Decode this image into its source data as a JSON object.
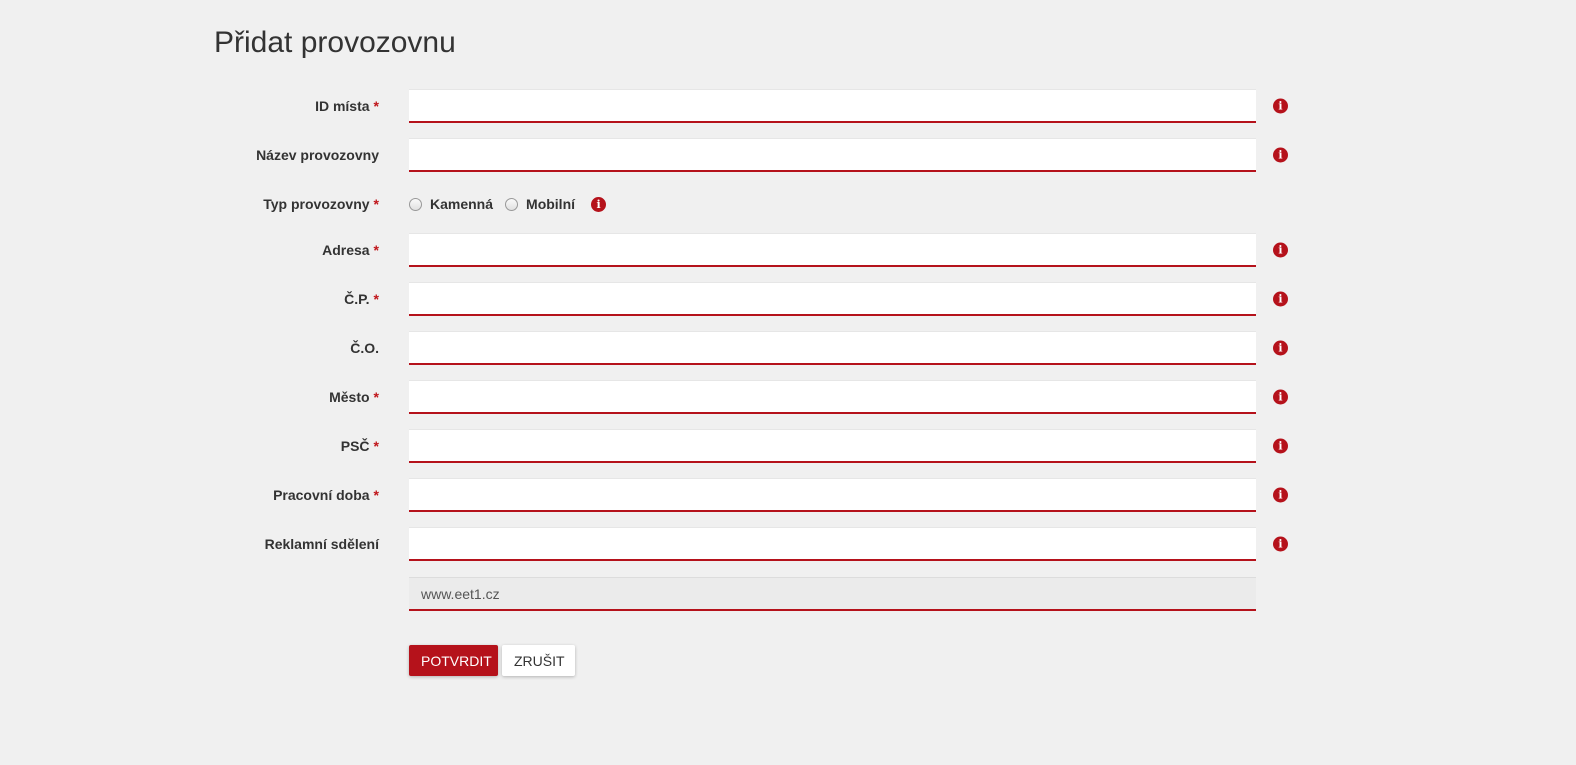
{
  "page": {
    "title": "Přidat provozovnu"
  },
  "form": {
    "required_marker": "*",
    "info_glyph": "i",
    "fields": {
      "id_mista": {
        "label": "ID místa",
        "value": ""
      },
      "nazev": {
        "label": "Název provozovny",
        "value": ""
      },
      "typ": {
        "label": "Typ provozovny",
        "options": [
          "Kamenná",
          "Mobilní"
        ],
        "selected": null
      },
      "adresa": {
        "label": "Adresa",
        "value": ""
      },
      "cp": {
        "label": "Č.P.",
        "value": ""
      },
      "co": {
        "label": "Č.O.",
        "value": ""
      },
      "mesto": {
        "label": "Město",
        "value": ""
      },
      "psc": {
        "label": "PSČ",
        "value": ""
      },
      "pracovni_doba": {
        "label": "Pracovní doba",
        "value": ""
      },
      "reklamni_sdeleni": {
        "label": "Reklamní sdělení",
        "value": ""
      },
      "web": {
        "value": "www.eet1.cz"
      }
    },
    "buttons": {
      "confirm": "POTVRDIT",
      "cancel": "ZRUŠIT"
    }
  },
  "colors": {
    "accent": "#b5121b",
    "background": "#f0f0f0"
  },
  "icons": {
    "info": "info-icon"
  }
}
